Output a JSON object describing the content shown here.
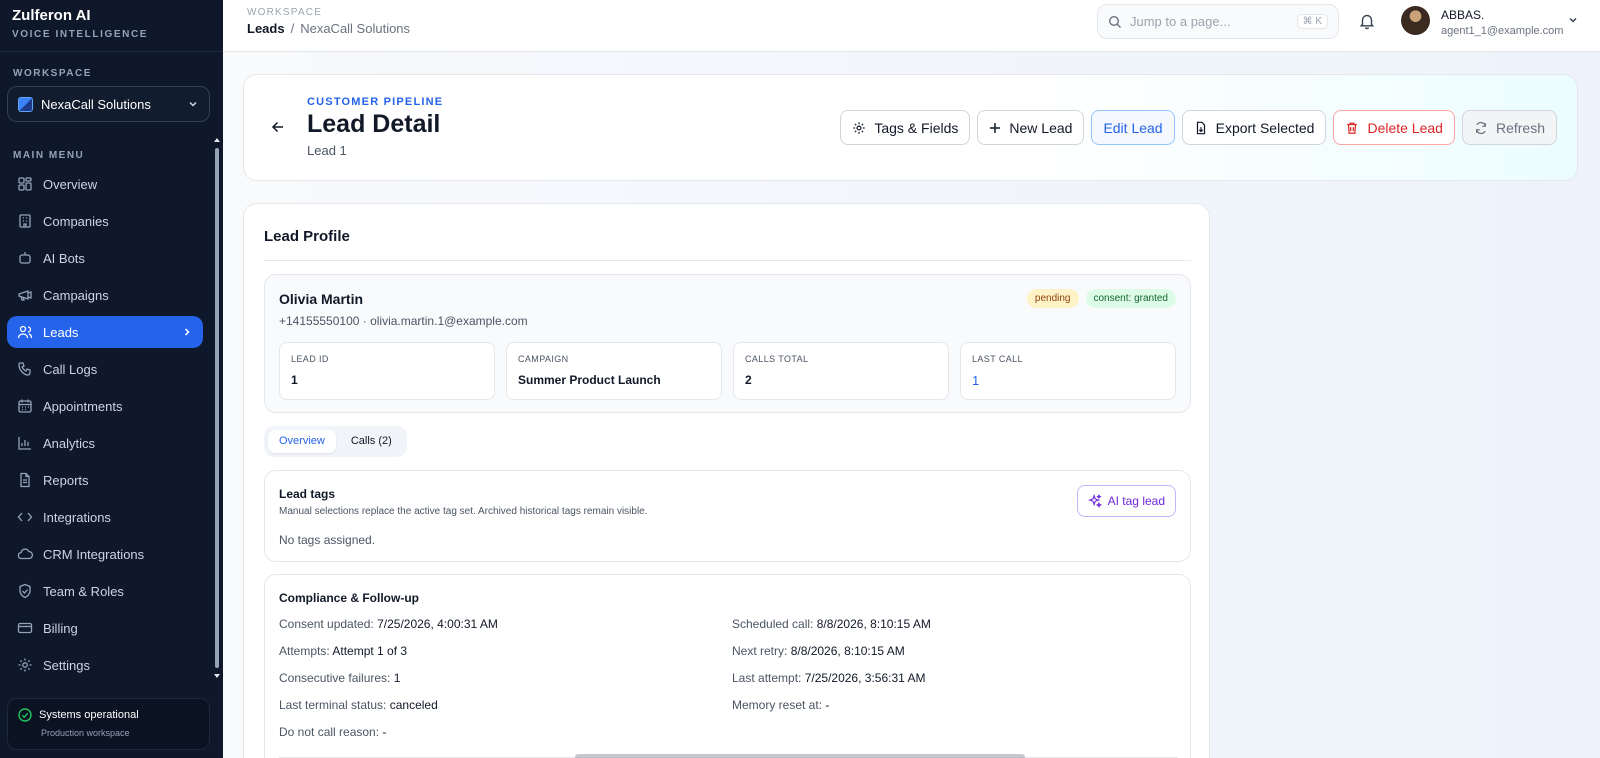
{
  "brand": {
    "title": "Zulferon AI",
    "subtitle": "VOICE INTELLIGENCE"
  },
  "sidebar": {
    "workspace_label": "WORKSPACE",
    "workspace_value": "NexaCall Solutions",
    "menu_label": "MAIN MENU",
    "items": [
      {
        "label": "Overview",
        "icon": "grid-icon"
      },
      {
        "label": "Companies",
        "icon": "building-icon"
      },
      {
        "label": "AI Bots",
        "icon": "bot-icon"
      },
      {
        "label": "Campaigns",
        "icon": "megaphone-icon"
      },
      {
        "label": "Leads",
        "icon": "users-icon",
        "active": true
      },
      {
        "label": "Call Logs",
        "icon": "phone-icon"
      },
      {
        "label": "Appointments",
        "icon": "calendar-icon"
      },
      {
        "label": "Analytics",
        "icon": "bar-chart-icon"
      },
      {
        "label": "Reports",
        "icon": "file-icon"
      },
      {
        "label": "Integrations",
        "icon": "code-icon"
      },
      {
        "label": "CRM Integrations",
        "icon": "cloud-icon"
      },
      {
        "label": "Team & Roles",
        "icon": "shield-icon"
      },
      {
        "label": "Billing",
        "icon": "credit-card-icon"
      },
      {
        "label": "Settings",
        "icon": "gear-icon"
      }
    ],
    "status": {
      "text": "Systems operational",
      "sub": "Production workspace"
    }
  },
  "topbar": {
    "label": "WORKSPACE",
    "crumb1": "Leads",
    "crumb_sep": "/",
    "crumb2": "NexaCall Solutions",
    "search_placeholder": "Jump to a page...",
    "search_shortcut": "⌘ K",
    "user_name": "ABBAS.",
    "user_email": "agent1_1@example.com"
  },
  "header": {
    "eyebrow": "CUSTOMER PIPELINE",
    "title": "Lead Detail",
    "subtitle": "Lead 1",
    "buttons": {
      "tags": "Tags & Fields",
      "new": "New Lead",
      "edit": "Edit Lead",
      "export": "Export Selected",
      "delete": "Delete Lead",
      "refresh": "Refresh"
    }
  },
  "profile": {
    "title": "Lead Profile",
    "name": "Olivia Martin",
    "contact": "+14155550100 · olivia.martin.1@example.com",
    "badges": {
      "status": "pending",
      "consent": "consent: granted"
    },
    "stats": [
      {
        "label": "LEAD ID",
        "value": "1"
      },
      {
        "label": "CAMPAIGN",
        "value": "Summer Product Launch"
      },
      {
        "label": "CALLS TOTAL",
        "value": "2"
      },
      {
        "label": "LAST CALL",
        "value": "1"
      }
    ],
    "tabs": [
      "Overview",
      "Calls (2)"
    ],
    "tags": {
      "title": "Lead tags",
      "desc": "Manual selections replace the active tag set. Archived historical tags remain visible.",
      "empty": "No tags assigned.",
      "ai_button": "AI tag lead"
    },
    "compliance": {
      "title": "Compliance & Follow-up",
      "left": [
        {
          "k": "Consent updated:",
          "v": "7/25/2026, 4:00:31 AM"
        },
        {
          "k": "Attempts:",
          "v": "Attempt 1 of 3"
        },
        {
          "k": "Consecutive failures:",
          "v": "1"
        },
        {
          "k": "Last terminal status:",
          "v": "canceled"
        },
        {
          "k": "Do not call reason:",
          "v": "-"
        }
      ],
      "right": [
        {
          "k": "Scheduled call:",
          "v": "8/8/2026, 8:10:15 AM"
        },
        {
          "k": "Next retry:",
          "v": "8/8/2026, 8:10:15 AM"
        },
        {
          "k": "Last attempt:",
          "v": "7/25/2026, 3:56:31 AM"
        },
        {
          "k": "Memory reset at:",
          "v": "-"
        }
      ]
    }
  }
}
